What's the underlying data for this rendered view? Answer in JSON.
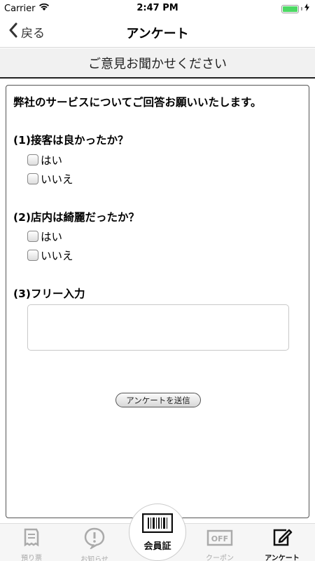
{
  "status": {
    "carrier": "Carrier",
    "time": "2:47 PM"
  },
  "nav": {
    "back_label": "戻る",
    "title": "アンケート"
  },
  "section": {
    "title": "ご意見お聞かせください"
  },
  "form": {
    "intro": "弊社のサービスについてご回答お願いいたします。",
    "q1": {
      "label": "(1)接客は良かったか？",
      "options": [
        "はい",
        "いいえ"
      ]
    },
    "q2": {
      "label": "(2)店内は綺麗だったか？",
      "options": [
        "はい",
        "いいえ"
      ]
    },
    "q3": {
      "label": "(3)フリー入力",
      "value": ""
    },
    "submit_label": "アンケートを送信"
  },
  "tabs": {
    "t1": "預り票",
    "t2": "お知らせ",
    "center": "会員証",
    "t4": "クーポン",
    "t5": "アンケート",
    "coupon_icon_text": "OFF",
    "active": "t5"
  }
}
